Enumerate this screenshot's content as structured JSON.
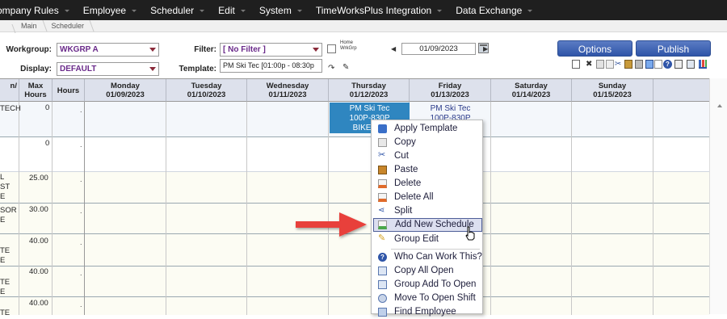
{
  "topnav": {
    "items": [
      "ompany Rules",
      "Employee",
      "Scheduler",
      "Edit",
      "System",
      "TimeWorksPlus Integration",
      "Data Exchange"
    ]
  },
  "breadcrumb": {
    "items": [
      "",
      "Main",
      "Scheduler"
    ]
  },
  "toolbar": {
    "workgroup_label": "Workgroup:",
    "workgroup_value": "WKGRP A",
    "display_label": "Display:",
    "display_value": "DEFAULT",
    "filter_label": "Filter:",
    "filter_value": "[ No Filter ]",
    "home_wkgrp_line1": "Home",
    "home_wkgrp_line2": "WrkGrp",
    "date_value": "01/09/2023",
    "template_label": "Template:",
    "template_value": "PM Ski Tec [01:00p - 08:30p",
    "options_button": "Options",
    "publish_button": "Publish"
  },
  "grid": {
    "headers": {
      "col_left": "n/",
      "max_hours": "Max\nHours",
      "hours": "Hours"
    },
    "days": [
      {
        "name": "Monday",
        "date": "01/09/2023"
      },
      {
        "name": "Tuesday",
        "date": "01/10/2023"
      },
      {
        "name": "Wednesday",
        "date": "01/11/2023"
      },
      {
        "name": "Thursday",
        "date": "01/12/2023"
      },
      {
        "name": "Friday",
        "date": "01/13/2023"
      },
      {
        "name": "Saturday",
        "date": "01/14/2023"
      },
      {
        "name": "Sunday",
        "date": "01/15/2023"
      }
    ],
    "rows": [
      {
        "left": [
          "TECH"
        ],
        "max": "0",
        "hours": "."
      },
      {
        "left": [],
        "max": "0",
        "hours": "."
      },
      {
        "left": [
          "L",
          "ST",
          "E"
        ],
        "max": "25.00",
        "hours": "."
      },
      {
        "left": [
          "SOR",
          "E"
        ],
        "max": "30.00",
        "hours": "."
      },
      {
        "left": [
          "TE",
          "E"
        ],
        "max": "40.00",
        "hours": "."
      },
      {
        "left": [
          "TE",
          "E"
        ],
        "max": "40.00",
        "hours": "."
      },
      {
        "left": [
          "TE"
        ],
        "max": "40.00",
        "hours": "."
      }
    ],
    "thursday_shift": [
      "PM Ski Tec",
      "100P-830P",
      "BIKE/SKI"
    ],
    "friday_shift": [
      "PM Ski Tec",
      "100P-830P"
    ]
  },
  "context_menu": {
    "items": [
      {
        "label": "Apply Template",
        "icon": "template-icon"
      },
      {
        "label": "Copy",
        "icon": "copy-icon"
      },
      {
        "label": "Cut",
        "icon": "scissors-icon"
      },
      {
        "label": "Paste",
        "icon": "paste-icon"
      },
      {
        "label": "Delete",
        "icon": "delete-icon"
      },
      {
        "label": "Delete All",
        "icon": "delete-all-icon"
      },
      {
        "label": "Split",
        "icon": "split-icon"
      },
      {
        "label": "Add New Schedule",
        "icon": "add-schedule-icon",
        "highlighted": true
      },
      {
        "label": "Group Edit",
        "icon": "group-edit-icon"
      },
      {
        "label": "Who Can Work This?",
        "icon": "help-icon"
      },
      {
        "label": "Copy All Open",
        "icon": "copy-open-icon"
      },
      {
        "label": "Group Add To Open",
        "icon": "group-add-icon"
      },
      {
        "label": "Move To Open Shift",
        "icon": "move-icon"
      },
      {
        "label": "Find Employee",
        "icon": "find-icon"
      }
    ]
  },
  "colors": {
    "nav_bg": "#1f1f1f",
    "header_bg": "#dde1ec",
    "button_blue": "#2f55a8",
    "shift_blue": "#2f86c0",
    "highlight_arrow": "#e8403a"
  }
}
